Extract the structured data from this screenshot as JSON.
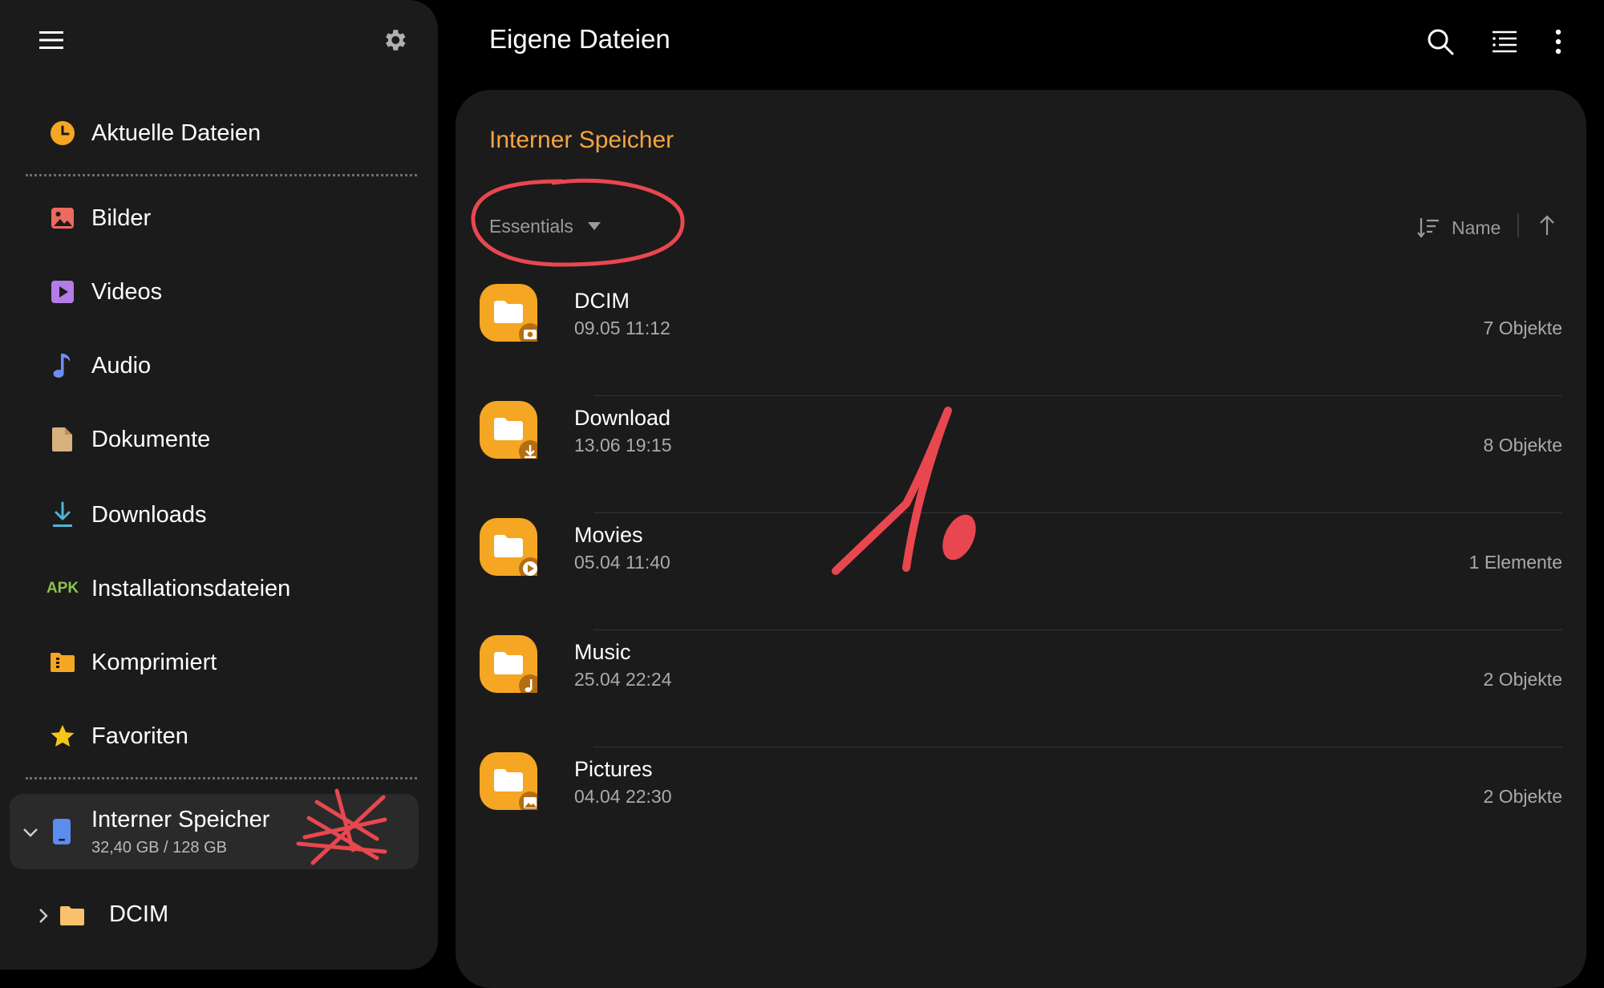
{
  "header": {
    "title": "Eigene Dateien",
    "icons": {
      "search": "search-icon",
      "filter": "filter-list-icon",
      "more": "more-vert-icon"
    }
  },
  "sidebar": {
    "menu_icon": "hamburger-menu-icon",
    "settings_icon": "gear-icon",
    "items": [
      {
        "label": "Aktuelle Dateien",
        "icon": "clock-icon",
        "color": "#f5a623"
      },
      {
        "label": "Bilder",
        "icon": "image-icon",
        "color": "#ec6a5e"
      },
      {
        "label": "Videos",
        "icon": "video-play-icon",
        "color": "#b47ce6"
      },
      {
        "label": "Audio",
        "icon": "music-note-icon",
        "color": "#6c8ef5"
      },
      {
        "label": "Dokumente",
        "icon": "document-icon",
        "color": "#d8b27c"
      },
      {
        "label": "Downloads",
        "icon": "download-icon",
        "color": "#4fb4d8"
      },
      {
        "label": "Installationsdateien",
        "icon": "apk-icon",
        "icon_text": "APK",
        "color": "#8bc34a"
      },
      {
        "label": "Komprimiert",
        "icon": "archive-folder-icon",
        "color": "#f5a623"
      },
      {
        "label": "Favoriten",
        "icon": "star-icon",
        "color": "#f5c518"
      }
    ],
    "storage": {
      "label": "Interner Speicher",
      "usage": "32,40 GB / 128 GB",
      "icon": "phone-storage-icon",
      "color": "#5b8def"
    },
    "tree": [
      {
        "label": "DCIM",
        "icon": "folder-icon",
        "color": "#f7c26b"
      }
    ]
  },
  "main": {
    "location": "Interner Speicher",
    "category": "Essentials",
    "sort": {
      "label": "Name",
      "direction": "ascending"
    },
    "files": [
      {
        "name": "DCIM",
        "date": "09.05 11:12",
        "count": "7 Objekte",
        "badge": "camera-badge-icon"
      },
      {
        "name": "Download",
        "date": "13.06 19:15",
        "count": "8 Objekte",
        "badge": "download-badge-icon"
      },
      {
        "name": "Movies",
        "date": "05.04 11:40",
        "count": "1 Elemente",
        "badge": "play-badge-icon"
      },
      {
        "name": "Music",
        "date": "25.04 22:24",
        "count": "2 Objekte",
        "badge": "music-badge-icon"
      },
      {
        "name": "Pictures",
        "date": "04.04 22:30",
        "count": "2 Objekte",
        "badge": "image-badge-icon"
      }
    ]
  },
  "colors": {
    "accent": "#f5a442",
    "folder": "#f5a623",
    "annotation_red": "#e8474f",
    "panel": "#1b1b1b",
    "background": "#000000"
  }
}
